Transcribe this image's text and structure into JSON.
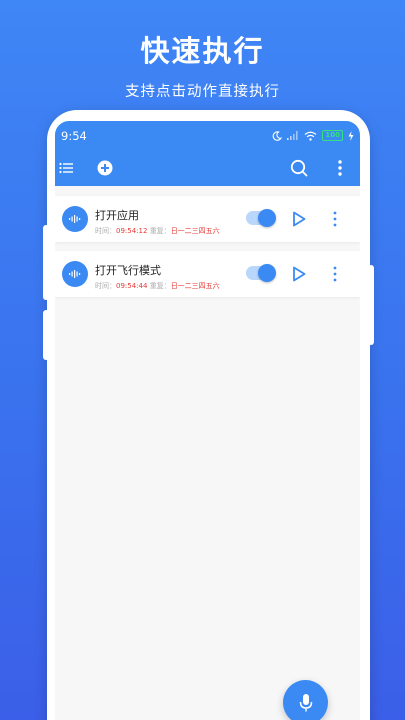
{
  "promo": {
    "headline": "快速执行",
    "subline": "支持点击动作直接执行"
  },
  "status_bar": {
    "time": "9:54",
    "battery": "100"
  },
  "toolbar": {
    "icons": [
      "list-icon",
      "add-icon",
      "search-icon",
      "more-vertical-icon"
    ]
  },
  "tasks": [
    {
      "title": "打开应用",
      "time_label": "时间：",
      "time_value": "09:54:12",
      "repeat_label": "重复：",
      "repeat_value": "日一二三四五六",
      "enabled": true
    },
    {
      "title": "打开飞行模式",
      "time_label": "时间：",
      "time_value": "09:54:44",
      "repeat_label": "重复：",
      "repeat_value": "日一二三四五六",
      "enabled": true
    }
  ],
  "colors": {
    "accent": "#3b8af4",
    "background_gradient_top": "#3f86f6",
    "background_gradient_bottom": "#3b5fe8",
    "repeat_text": "#e53935"
  }
}
